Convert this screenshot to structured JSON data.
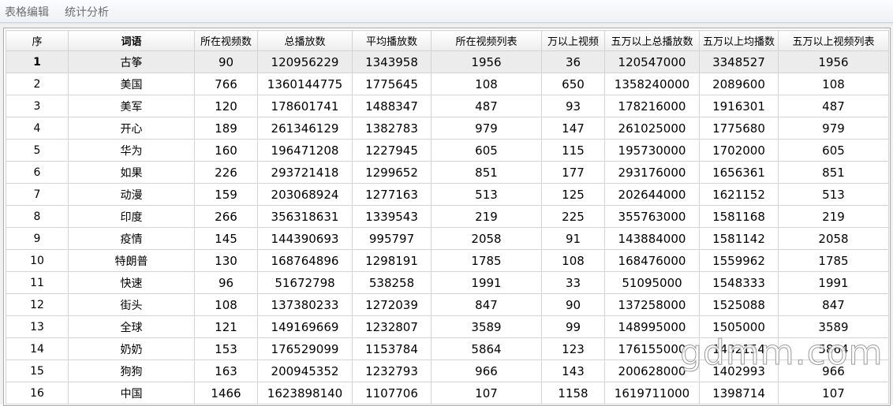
{
  "menu": [
    "表格编辑",
    "统计分析"
  ],
  "columns": [
    "序",
    "词语",
    "所在视频数",
    "总播放数",
    "平均播放数",
    "所在视频列表",
    "万以上视频",
    "五万以上总播放数",
    "五万以上均播数",
    "五万以上视频列表"
  ],
  "rows": [
    [
      "1",
      "古筝",
      "90",
      "120956229",
      "1343958",
      "1956",
      "36",
      "120547000",
      "3348527",
      "1956"
    ],
    [
      "2",
      "美国",
      "766",
      "1360144775",
      "1775645",
      "108",
      "650",
      "1358240000",
      "2089600",
      "108"
    ],
    [
      "3",
      "美军",
      "120",
      "178601741",
      "1488347",
      "487",
      "93",
      "178216000",
      "1916301",
      "487"
    ],
    [
      "4",
      "开心",
      "189",
      "261346129",
      "1382783",
      "979",
      "147",
      "261025000",
      "1775680",
      "979"
    ],
    [
      "5",
      "华为",
      "160",
      "196471208",
      "1227945",
      "605",
      "115",
      "195730000",
      "1702000",
      "605"
    ],
    [
      "6",
      "如果",
      "226",
      "293721418",
      "1299652",
      "851",
      "177",
      "293176000",
      "1656361",
      "851"
    ],
    [
      "7",
      "动漫",
      "159",
      "203068924",
      "1277163",
      "513",
      "125",
      "202644000",
      "1621152",
      "513"
    ],
    [
      "8",
      "印度",
      "266",
      "356318631",
      "1339543",
      "219",
      "225",
      "355763000",
      "1581168",
      "219"
    ],
    [
      "9",
      "疫情",
      "145",
      "144390693",
      "995797",
      "2058",
      "91",
      "143884000",
      "1581142",
      "2058"
    ],
    [
      "10",
      "特朗普",
      "130",
      "168764896",
      "1298191",
      "1785",
      "108",
      "168476000",
      "1559962",
      "1785"
    ],
    [
      "11",
      "快速",
      "96",
      "51672798",
      "538258",
      "1991",
      "33",
      "51095000",
      "1548333",
      "1991"
    ],
    [
      "12",
      "街头",
      "108",
      "137380233",
      "1272039",
      "847",
      "90",
      "137258000",
      "1525088",
      "847"
    ],
    [
      "13",
      "全球",
      "121",
      "149169669",
      "1232807",
      "3589",
      "99",
      "148995000",
      "1505000",
      "3589"
    ],
    [
      "14",
      "奶奶",
      "153",
      "176529099",
      "1153784",
      "5864",
      "123",
      "176155000",
      "1432154",
      "5864"
    ],
    [
      "15",
      "狗狗",
      "163",
      "200945352",
      "1232793",
      "966",
      "143",
      "200628000",
      "1402993",
      "966"
    ],
    [
      "16",
      "中国",
      "1466",
      "1623898140",
      "1107706",
      "107",
      "1158",
      "1619711000",
      "1398714",
      "107"
    ]
  ],
  "watermark": "gdmm.com"
}
